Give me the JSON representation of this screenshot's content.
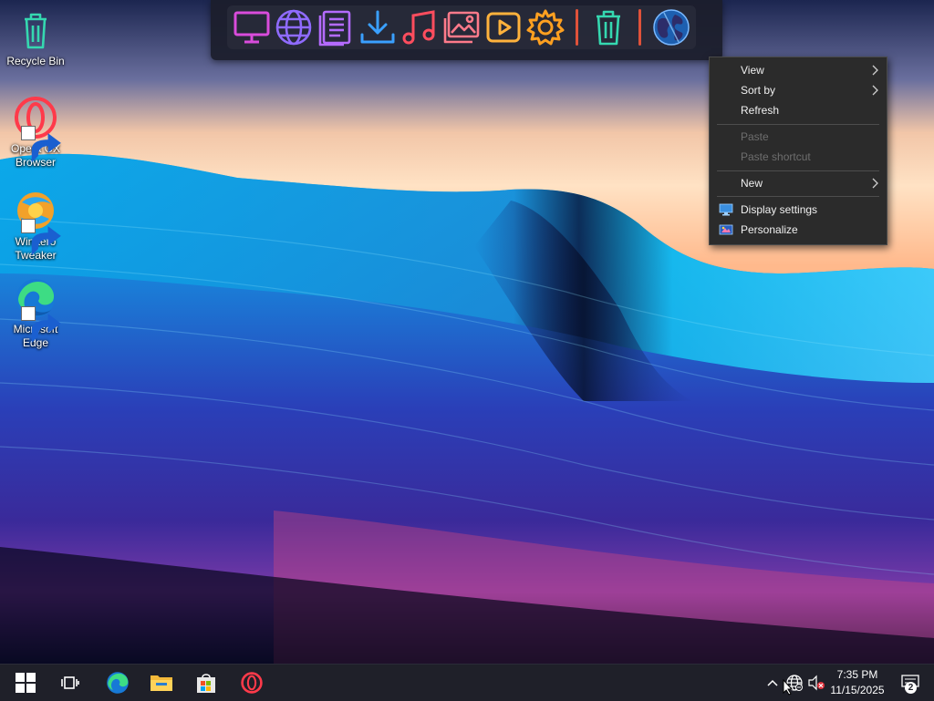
{
  "desktop": {
    "icons": [
      {
        "label": "Recycle Bin",
        "icon": "recycle-bin-icon"
      },
      {
        "label": "Opera GX Browser",
        "icon": "opera-gx-icon"
      },
      {
        "label": "Winaero Tweaker",
        "icon": "winaero-tweaker-icon"
      },
      {
        "label": "Microsoft Edge",
        "icon": "edge-icon"
      }
    ]
  },
  "dock": {
    "items": [
      "monitor-icon",
      "globe-icon",
      "document-icon",
      "download-icon",
      "music-icon",
      "image-icon",
      "video-icon",
      "gear-icon",
      "trash-icon",
      "earth-icon"
    ],
    "colors": {
      "pink": "#d94cdb",
      "purple": "#8f6bff",
      "blue": "#3aa0ff",
      "orange": "#ff7a3c",
      "red": "#ff4d5e",
      "yellow": "#ffd23c",
      "green": "#35d8b0"
    }
  },
  "context_menu": {
    "view": "View",
    "sort_by": "Sort by",
    "refresh": "Refresh",
    "paste": "Paste",
    "paste_shortcut": "Paste shortcut",
    "new": "New",
    "display_settings": "Display settings",
    "personalize": "Personalize"
  },
  "taskbar": {
    "apps": [
      "start-icon",
      "task-view-icon",
      "edge-icon",
      "file-explorer-icon",
      "store-icon",
      "opera-icon"
    ],
    "clock": {
      "time": "7:35 PM",
      "date": "11/15/2025"
    },
    "notification_count": "2",
    "background": "#1f2029"
  }
}
